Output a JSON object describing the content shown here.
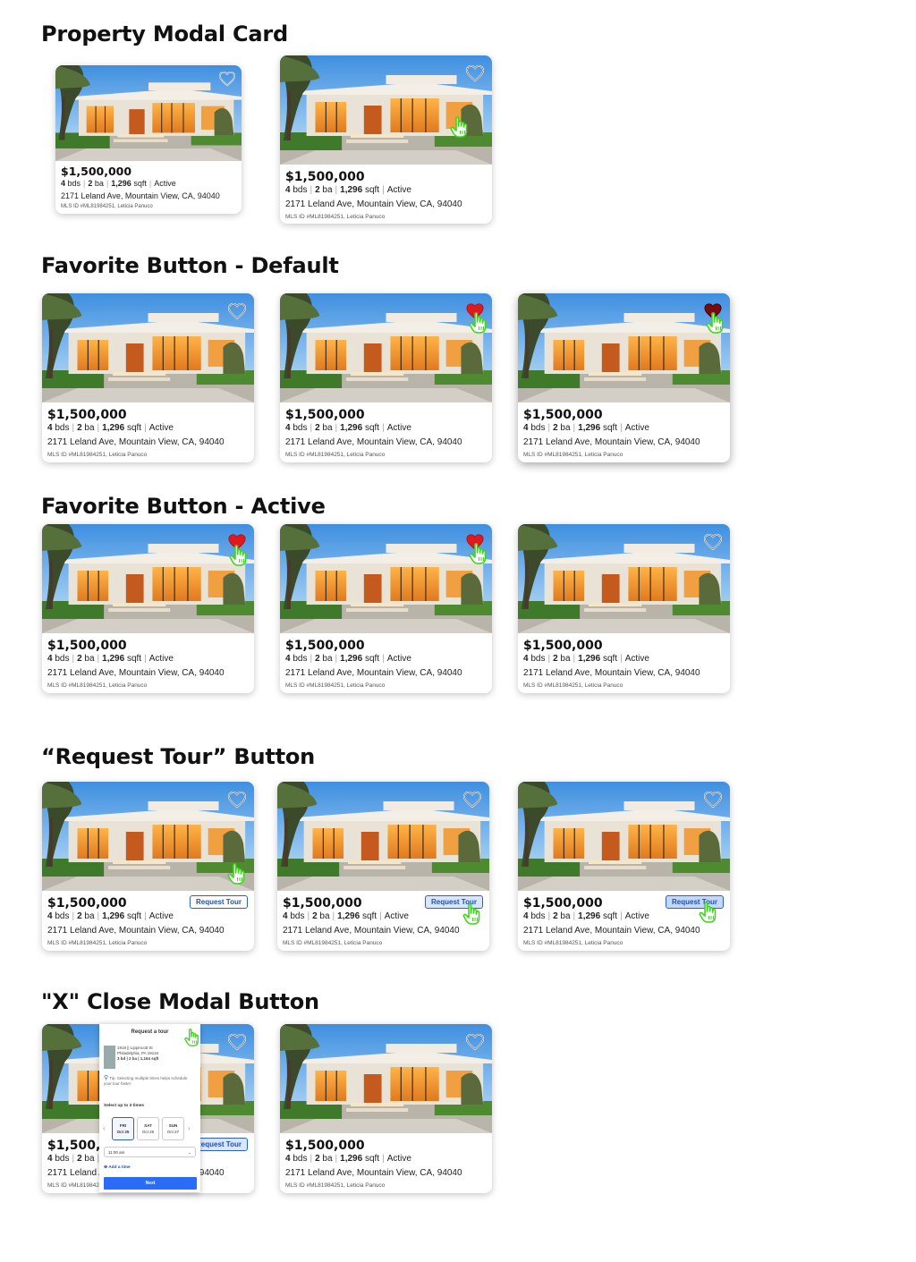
{
  "sections": {
    "modal_card": "Property Modal Card",
    "fav_default": "Favorite Button - Default",
    "fav_active": "Favorite Button - Active",
    "request_tour": "“Request Tour” Button",
    "close_modal": "\"X\" Close Modal Button"
  },
  "listing": {
    "price": "$1,500,000",
    "beds_num": "4",
    "beds_unit": "bds",
    "baths_num": "2",
    "baths_unit": "ba",
    "sqft_num": "1,296",
    "sqft_unit": "sqft",
    "status": "Active",
    "address": "2171 Leland Ave, Mountain View, CA, 94040",
    "mls": "MLS ID #ML81984251, Leticia Panuco"
  },
  "request_tour_label": "Request Tour",
  "modal": {
    "title": "Request a tour",
    "prop_line1": "1918 || Lippincott St",
    "prop_line2": "Philadelphia, PA 19134",
    "prop_line3": "3 bd | 2 ba | 1,164 sqft",
    "tip": "Tip: Selecting multiple times helps schedule your tour faster",
    "select_label": "Select up to 3 times",
    "days": [
      {
        "dow": "FRI",
        "date": "Oct 25"
      },
      {
        "dow": "SAT",
        "date": "Oct 26"
      },
      {
        "dow": "SUN",
        "date": "Oct 27"
      }
    ],
    "time": "11:00 am",
    "add_time": "Add a time",
    "next": "Next"
  },
  "colors": {
    "heart_active": "#e0191e",
    "cursor": "#3bd61a",
    "button_blue": "#2b5fd0"
  },
  "icons": [
    "heart-outline-icon",
    "heart-filled-icon",
    "pointer-hand-icon",
    "location-pin-icon",
    "chevron-down-icon"
  ]
}
